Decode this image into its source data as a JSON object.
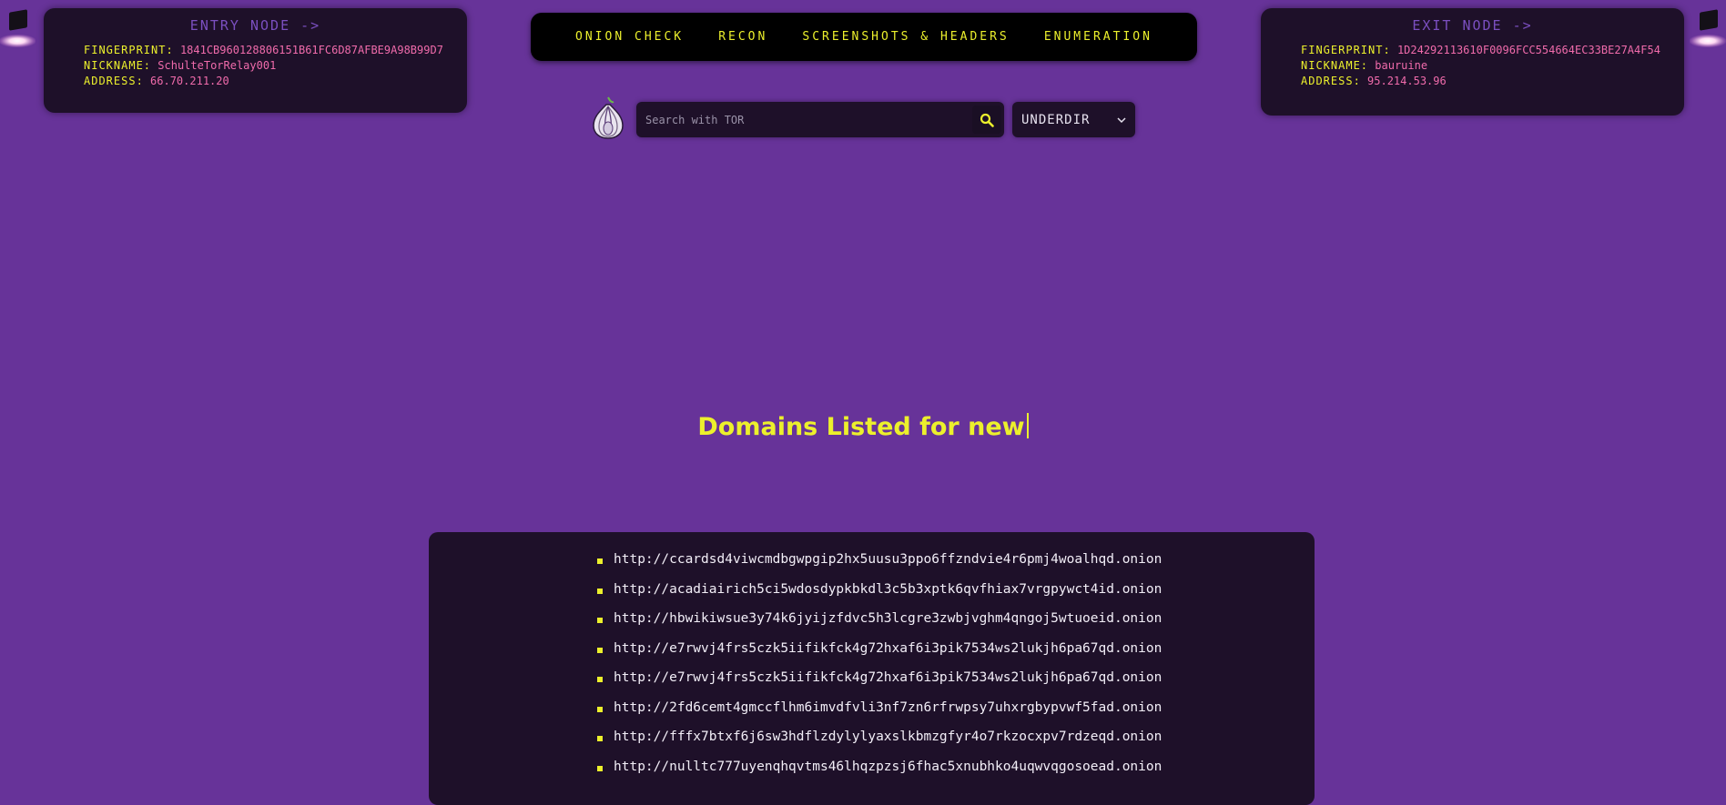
{
  "entry_node": {
    "title": "ENTRY NODE ->",
    "fingerprint_label": "FINGERPRINT:",
    "fingerprint": "1841CB960128806151B61FC6D87AFBE9A98B99D7",
    "nickname_label": "NICKNAME:",
    "nickname": "SchulteTorRelay001",
    "address_label": "ADDRESS:",
    "address": "66.70.211.20"
  },
  "exit_node": {
    "title": "EXIT NODE ->",
    "fingerprint_label": "FINGERPRINT:",
    "fingerprint": "1D24292113610F0096FCC554664EC33BE27A4F54",
    "nickname_label": "NICKNAME:",
    "nickname": "bauruine",
    "address_label": "ADDRESS:",
    "address": "95.214.53.96"
  },
  "nav": {
    "items": [
      "ONION CHECK",
      "RECON",
      "SCREENSHOTS & HEADERS",
      "ENUMERATION"
    ]
  },
  "search": {
    "placeholder": "Search with TOR",
    "icon": "search-icon"
  },
  "select": {
    "value": "UNDERDIR"
  },
  "results": {
    "title": "Domains Listed for new",
    "domains": [
      "http://ccardsd4viwcmdbgwpgip2hx5uusu3ppo6ffzndvie4r6pmj4woalhqd.onion",
      "http://acadiairich5ci5wdosdypkbkdl3c5b3xptk6qvfhiax7vrgpywct4id.onion",
      "http://hbwikiwsue3y74k6jyijzfdvc5h3lcgre3zwbjvghm4qngoj5wtuoeid.onion",
      "http://e7rwvj4frs5czk5iifikfck4g72hxaf6i3pik7534ws2lukjh6pa67qd.onion",
      "http://e7rwvj4frs5czk5iifikfck4g72hxaf6i3pik7534ws2lukjh6pa67qd.onion",
      "http://2fd6cemt4gmccflhm6imvdfvli3nf7zn6rfrwpsy7uhxrgbypvwf5fad.onion",
      "http://fffx7btxf6j6sw3hdflzdylylyaxslkbmzgfyr4o7rkzocxpv7rdzeqd.onion",
      "http://nulltc777uyenqhqvtms46lhqzpzsj6fhac5xnubhko4uqwvqgosoead.onion"
    ]
  },
  "colors": {
    "background": "#673399",
    "panel": "#1e1029",
    "accent_yellow": "#ecf02c",
    "value_pink": "#f06bab",
    "node_title": "#7b4fc0"
  }
}
